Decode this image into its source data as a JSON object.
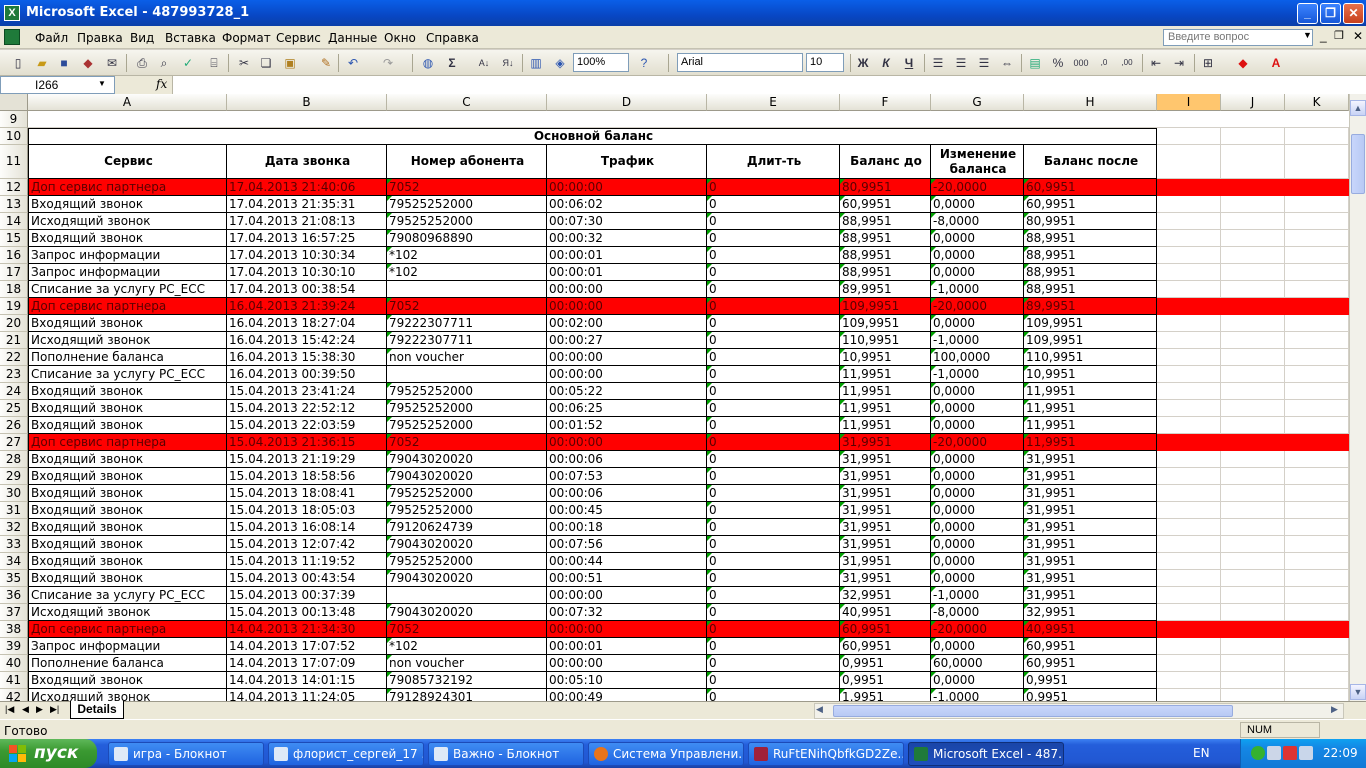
{
  "window": {
    "title": "Microsoft Excel - 487993728_1"
  },
  "menu": {
    "items": [
      "Файл",
      "Правка",
      "Вид",
      "Вставка",
      "Формат",
      "Сервис",
      "Данные",
      "Окно",
      "Справка"
    ],
    "help_placeholder": "Введите вопрос"
  },
  "toolbar": {
    "zoom": "100%",
    "font": "Arial",
    "font_size": "10"
  },
  "formula_bar": {
    "name_box": "I266",
    "fx_label": "fx",
    "formula": ""
  },
  "columns": [
    "A",
    "B",
    "C",
    "D",
    "E",
    "F",
    "G",
    "H",
    "I",
    "J",
    "K"
  ],
  "selected_column": "I",
  "sheet": {
    "section_title": "Основной баланс",
    "headers": [
      "Сервис",
      "Дата звонка",
      "Номер абонента",
      "Трафик",
      "Длит-ть",
      "Баланс до",
      "Изменение баланса",
      "Баланс после"
    ],
    "rows": [
      {
        "n": "12",
        "red": true,
        "c": [
          "Доп сервис партнера",
          "17.04.2013 21:40:06",
          "7052",
          "00:00:00",
          "0",
          "80,9951",
          "-20,0000",
          "60,9951"
        ]
      },
      {
        "n": "13",
        "red": false,
        "c": [
          "Входящий звонок",
          "17.04.2013 21:35:31",
          "79525252000",
          "00:06:02",
          "0",
          "60,9951",
          "0,0000",
          "60,9951"
        ]
      },
      {
        "n": "14",
        "red": false,
        "c": [
          "Исходящий звонок",
          "17.04.2013 21:08:13",
          "79525252000",
          "00:07:30",
          "0",
          "88,9951",
          "-8,0000",
          "80,9951"
        ]
      },
      {
        "n": "15",
        "red": false,
        "c": [
          "Входящий звонок",
          "17.04.2013 16:57:25",
          "79080968890",
          "00:00:32",
          "0",
          "88,9951",
          "0,0000",
          "88,9951"
        ]
      },
      {
        "n": "16",
        "red": false,
        "c": [
          "Запрос информации",
          "17.04.2013 10:30:34",
          "*102",
          "00:00:01",
          "0",
          "88,9951",
          "0,0000",
          "88,9951"
        ]
      },
      {
        "n": "17",
        "red": false,
        "c": [
          "Запрос информации",
          "17.04.2013 10:30:10",
          "*102",
          "00:00:01",
          "0",
          "88,9951",
          "0,0000",
          "88,9951"
        ]
      },
      {
        "n": "18",
        "red": false,
        "c": [
          "Списание за услугу PC_ECC",
          "17.04.2013 00:38:54",
          "",
          "00:00:00",
          "0",
          "89,9951",
          "-1,0000",
          "88,9951"
        ]
      },
      {
        "n": "19",
        "red": true,
        "c": [
          "Доп сервис партнера",
          "16.04.2013 21:39:24",
          "7052",
          "00:00:00",
          "0",
          "109,9951",
          "-20,0000",
          "89,9951"
        ]
      },
      {
        "n": "20",
        "red": false,
        "c": [
          "Входящий звонок",
          "16.04.2013 18:27:04",
          "79222307711",
          "00:02:00",
          "0",
          "109,9951",
          "0,0000",
          "109,9951"
        ]
      },
      {
        "n": "21",
        "red": false,
        "c": [
          "Исходящий звонок",
          "16.04.2013 15:42:24",
          "79222307711",
          "00:00:27",
          "0",
          "110,9951",
          "-1,0000",
          "109,9951"
        ]
      },
      {
        "n": "22",
        "red": false,
        "c": [
          "Пополнение баланса",
          "16.04.2013 15:38:30",
          "non voucher",
          "00:00:00",
          "0",
          "10,9951",
          "100,0000",
          "110,9951"
        ]
      },
      {
        "n": "23",
        "red": false,
        "c": [
          "Списание за услугу PC_ECC",
          "16.04.2013 00:39:50",
          "",
          "00:00:00",
          "0",
          "11,9951",
          "-1,0000",
          "10,9951"
        ]
      },
      {
        "n": "24",
        "red": false,
        "c": [
          "Входящий звонок",
          "15.04.2013 23:41:24",
          "79525252000",
          "00:05:22",
          "0",
          "11,9951",
          "0,0000",
          "11,9951"
        ]
      },
      {
        "n": "25",
        "red": false,
        "c": [
          "Входящий звонок",
          "15.04.2013 22:52:12",
          "79525252000",
          "00:06:25",
          "0",
          "11,9951",
          "0,0000",
          "11,9951"
        ]
      },
      {
        "n": "26",
        "red": false,
        "c": [
          "Входящий звонок",
          "15.04.2013 22:03:59",
          "79525252000",
          "00:01:52",
          "0",
          "11,9951",
          "0,0000",
          "11,9951"
        ]
      },
      {
        "n": "27",
        "red": true,
        "c": [
          "Доп сервис партнера",
          "15.04.2013 21:36:15",
          "7052",
          "00:00:00",
          "0",
          "31,9951",
          "-20,0000",
          "11,9951"
        ]
      },
      {
        "n": "28",
        "red": false,
        "c": [
          "Входящий звонок",
          "15.04.2013 21:19:29",
          "79043020020",
          "00:00:06",
          "0",
          "31,9951",
          "0,0000",
          "31,9951"
        ]
      },
      {
        "n": "29",
        "red": false,
        "c": [
          "Входящий звонок",
          "15.04.2013 18:58:56",
          "79043020020",
          "00:07:53",
          "0",
          "31,9951",
          "0,0000",
          "31,9951"
        ]
      },
      {
        "n": "30",
        "red": false,
        "c": [
          "Входящий звонок",
          "15.04.2013 18:08:41",
          "79525252000",
          "00:00:06",
          "0",
          "31,9951",
          "0,0000",
          "31,9951"
        ]
      },
      {
        "n": "31",
        "red": false,
        "c": [
          "Входящий звонок",
          "15.04.2013 18:05:03",
          "79525252000",
          "00:00:45",
          "0",
          "31,9951",
          "0,0000",
          "31,9951"
        ]
      },
      {
        "n": "32",
        "red": false,
        "c": [
          "Входящий звонок",
          "15.04.2013 16:08:14",
          "79120624739",
          "00:00:18",
          "0",
          "31,9951",
          "0,0000",
          "31,9951"
        ]
      },
      {
        "n": "33",
        "red": false,
        "c": [
          "Входящий звонок",
          "15.04.2013 12:07:42",
          "79043020020",
          "00:07:56",
          "0",
          "31,9951",
          "0,0000",
          "31,9951"
        ]
      },
      {
        "n": "34",
        "red": false,
        "c": [
          "Входящий звонок",
          "15.04.2013 11:19:52",
          "79525252000",
          "00:00:44",
          "0",
          "31,9951",
          "0,0000",
          "31,9951"
        ]
      },
      {
        "n": "35",
        "red": false,
        "c": [
          "Входящий звонок",
          "15.04.2013 00:43:54",
          "79043020020",
          "00:00:51",
          "0",
          "31,9951",
          "0,0000",
          "31,9951"
        ]
      },
      {
        "n": "36",
        "red": false,
        "c": [
          "Списание за услугу PC_ECC",
          "15.04.2013 00:37:39",
          "",
          "00:00:00",
          "0",
          "32,9951",
          "-1,0000",
          "31,9951"
        ]
      },
      {
        "n": "37",
        "red": false,
        "c": [
          "Исходящий звонок",
          "15.04.2013 00:13:48",
          "79043020020",
          "00:07:32",
          "0",
          "40,9951",
          "-8,0000",
          "32,9951"
        ]
      },
      {
        "n": "38",
        "red": true,
        "c": [
          "Доп сервис партнера",
          "14.04.2013 21:34:30",
          "7052",
          "00:00:00",
          "0",
          "60,9951",
          "-20,0000",
          "40,9951"
        ]
      },
      {
        "n": "39",
        "red": false,
        "c": [
          "Запрос информации",
          "14.04.2013 17:07:52",
          "*102",
          "00:00:01",
          "0",
          "60,9951",
          "0,0000",
          "60,9951"
        ]
      },
      {
        "n": "40",
        "red": false,
        "c": [
          "Пополнение баланса",
          "14.04.2013 17:07:09",
          "non voucher",
          "00:00:00",
          "0",
          "0,9951",
          "60,0000",
          "60,9951"
        ]
      },
      {
        "n": "41",
        "red": false,
        "c": [
          "Входящий звонок",
          "14.04.2013 14:01:15",
          "79085732192",
          "00:05:10",
          "0",
          "0,9951",
          "0,0000",
          "0,9951"
        ]
      },
      {
        "n": "42",
        "red": false,
        "c": [
          "Исходящий звонок",
          "14.04.2013 11:24:05",
          "79128924301",
          "00:00:49",
          "0",
          "1,9951",
          "-1,0000",
          "0,9951"
        ]
      }
    ]
  },
  "sheet_tab": "Details",
  "status": {
    "text": "Готово",
    "num": "NUM"
  },
  "taskbar": {
    "start": "пуск",
    "tasks": [
      "игра - Блокнот",
      "флорист_сергей_17 ...",
      "Важно - Блокнот",
      "Система Управлени...",
      "RuFtENihQbfkGD2Ze...",
      "Microsoft Excel - 487..."
    ],
    "lang": "EN",
    "clock": "22:09"
  },
  "colors": {
    "highlight_row": "#ff0000",
    "selected_col_header": "#ffc66e",
    "xp_blue": "#0a5fe8",
    "start_green": "#3b9a32"
  }
}
